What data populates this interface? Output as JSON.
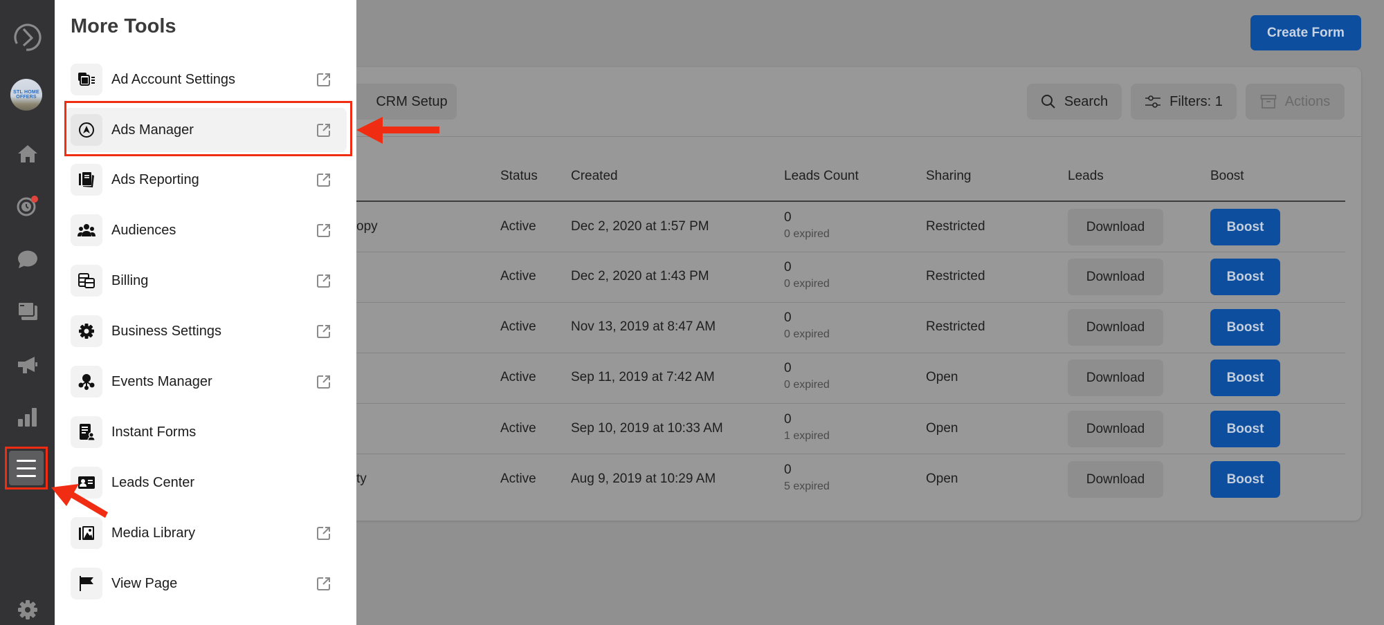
{
  "left_nav": {
    "items": [
      {
        "name": "meta-business-logo-icon"
      },
      {
        "name": "page-avatar",
        "text_lines": [
          "STL HOME",
          "OFFERS"
        ]
      },
      {
        "name": "home-icon"
      },
      {
        "name": "activity-notifications-icon",
        "has_badge": true
      },
      {
        "name": "inbox-chat-icon"
      },
      {
        "name": "posts-stories-icon"
      },
      {
        "name": "ads-megaphone-icon"
      },
      {
        "name": "insights-bar-chart-icon"
      },
      {
        "name": "all-tools-menu-icon",
        "selected": true
      },
      {
        "name": "settings-gear-icon"
      }
    ]
  },
  "drawer": {
    "title": "More Tools",
    "items": [
      {
        "label": "Ad Account Settings",
        "icon": "ad-account-settings-icon",
        "external": true
      },
      {
        "label": "Ads Manager",
        "icon": "ads-manager-icon",
        "external": true,
        "highlighted": true
      },
      {
        "label": "Ads Reporting",
        "icon": "ads-reporting-icon",
        "external": true
      },
      {
        "label": "Audiences",
        "icon": "audiences-icon",
        "external": true
      },
      {
        "label": "Billing",
        "icon": "billing-icon",
        "external": true
      },
      {
        "label": "Business Settings",
        "icon": "business-settings-icon",
        "external": true
      },
      {
        "label": "Events Manager",
        "icon": "events-manager-icon",
        "external": true
      },
      {
        "label": "Instant Forms",
        "icon": "instant-forms-icon",
        "external": false
      },
      {
        "label": "Leads Center",
        "icon": "leads-center-icon",
        "external": false
      },
      {
        "label": "Media Library",
        "icon": "media-library-icon",
        "external": true
      },
      {
        "label": "View Page",
        "icon": "view-page-flag-icon",
        "external": true
      }
    ]
  },
  "main": {
    "create_form_label": "Create Form",
    "toolbar": {
      "crm_setup_label": "CRM Setup",
      "search_label": "Search",
      "filters_label": "Filters: 1",
      "actions_label": "Actions"
    },
    "table": {
      "columns": [
        "Status",
        "Created",
        "Leads Count",
        "Sharing",
        "Leads",
        "Boost"
      ],
      "rows": [
        {
          "name_fragment": "opy",
          "status": "Active",
          "created": "Dec 2, 2020 at 1:57 PM",
          "leads_count": "0",
          "expired": "0 expired",
          "sharing": "Restricted",
          "leads_btn": "Download",
          "boost_btn": "Boost"
        },
        {
          "name_fragment": "",
          "status": "Active",
          "created": "Dec 2, 2020 at 1:43 PM",
          "leads_count": "0",
          "expired": "0 expired",
          "sharing": "Restricted",
          "leads_btn": "Download",
          "boost_btn": "Boost"
        },
        {
          "name_fragment": "",
          "status": "Active",
          "created": "Nov 13, 2019 at 8:47 AM",
          "leads_count": "0",
          "expired": "0 expired",
          "sharing": "Restricted",
          "leads_btn": "Download",
          "boost_btn": "Boost"
        },
        {
          "name_fragment": "",
          "status": "Active",
          "created": "Sep 11, 2019 at 7:42 AM",
          "leads_count": "0",
          "expired": "0 expired",
          "sharing": "Open",
          "leads_btn": "Download",
          "boost_btn": "Boost"
        },
        {
          "name_fragment": "",
          "status": "Active",
          "created": "Sep 10, 2019 at 10:33 AM",
          "leads_count": "0",
          "expired": "1 expired",
          "sharing": "Open",
          "leads_btn": "Download",
          "boost_btn": "Boost"
        },
        {
          "name_fragment": "ty",
          "status": "Active",
          "created": "Aug 9, 2019 at 10:29 AM",
          "leads_count": "0",
          "expired": "5 expired",
          "sharing": "Open",
          "leads_btn": "Download",
          "boost_btn": "Boost"
        }
      ]
    }
  },
  "colors": {
    "brand_blue": "#1877f2",
    "annotation_red": "#f02d12",
    "nav_bg": "#333335"
  }
}
